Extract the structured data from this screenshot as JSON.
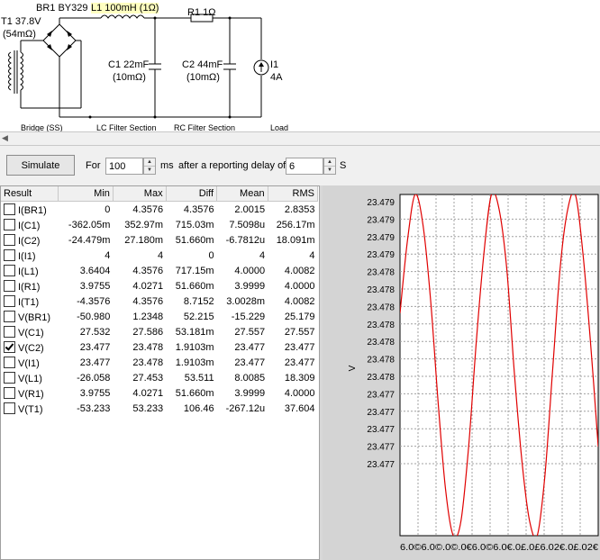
{
  "schematic": {
    "t1": {
      "name": "T1 37.8V",
      "res": "(54mΩ)"
    },
    "br1": "BR1 BY329",
    "l1": "L1 100mH (1Ω)",
    "r1": "R1 1Ω",
    "c1": {
      "name": "C1 22mF",
      "res": "(10mΩ)"
    },
    "c2": {
      "name": "C2 44mF",
      "res": "(10mΩ)"
    },
    "i1": {
      "name": "I1",
      "value": "4A"
    },
    "sections": [
      "Bridge (SS)",
      "LC Filter Section",
      "RC Filter Section",
      "Load"
    ]
  },
  "toolbar": {
    "simulate": "Simulate",
    "for": "For",
    "duration": "100",
    "ms": "ms",
    "delay_text": "after a reporting delay of",
    "delay": "6",
    "s": "S"
  },
  "results": {
    "headers": [
      "Result",
      "Min",
      "Max",
      "Diff",
      "Mean",
      "RMS"
    ],
    "rows": [
      {
        "checked": false,
        "cells": [
          "I(BR1)",
          "0",
          "4.3576",
          "4.3576",
          "2.0015",
          "2.8353"
        ]
      },
      {
        "checked": false,
        "cells": [
          "I(C1)",
          "-362.05m",
          "352.97m",
          "715.03m",
          "7.5098u",
          "256.17m"
        ]
      },
      {
        "checked": false,
        "cells": [
          "I(C2)",
          "-24.479m",
          "27.180m",
          "51.660m",
          "-6.7812u",
          "18.091m"
        ]
      },
      {
        "checked": false,
        "cells": [
          "I(I1)",
          "4",
          "4",
          "0",
          "4",
          "4"
        ]
      },
      {
        "checked": false,
        "cells": [
          "I(L1)",
          "3.6404",
          "4.3576",
          "717.15m",
          "4.0000",
          "4.0082"
        ]
      },
      {
        "checked": false,
        "cells": [
          "I(R1)",
          "3.9755",
          "4.0271",
          "51.660m",
          "3.9999",
          "4.0000"
        ]
      },
      {
        "checked": false,
        "cells": [
          "I(T1)",
          "-4.3576",
          "4.3576",
          "8.7152",
          "3.0028m",
          "4.0082"
        ]
      },
      {
        "checked": false,
        "cells": [
          "V(BR1)",
          "-50.980",
          "1.2348",
          "52.215",
          "-15.229",
          "25.179"
        ]
      },
      {
        "checked": false,
        "cells": [
          "V(C1)",
          "27.532",
          "27.586",
          "53.181m",
          "27.557",
          "27.557"
        ]
      },
      {
        "checked": true,
        "cells": [
          "V(C2)",
          "23.477",
          "23.478",
          "1.9103m",
          "23.477",
          "23.477"
        ]
      },
      {
        "checked": false,
        "cells": [
          "V(I1)",
          "23.477",
          "23.478",
          "1.9103m",
          "23.477",
          "23.477"
        ]
      },
      {
        "checked": false,
        "cells": [
          "V(L1)",
          "-26.058",
          "27.453",
          "53.511",
          "8.0085",
          "18.309"
        ]
      },
      {
        "checked": false,
        "cells": [
          "V(R1)",
          "3.9755",
          "4.0271",
          "51.660m",
          "3.9999",
          "4.0000"
        ]
      },
      {
        "checked": false,
        "cells": [
          "V(T1)",
          "-53.233",
          "53.233",
          "106.46",
          "-267.12u",
          "37.604"
        ]
      }
    ]
  },
  "chart_data": {
    "type": "line",
    "ylabel": "V",
    "y_ticks": [
      "23.479",
      "23.479",
      "23.479",
      "23.479",
      "23.478",
      "23.478",
      "23.478",
      "23.478",
      "23.478",
      "23.478",
      "23.478",
      "23.477",
      "23.477",
      "23.477",
      "23.477",
      "23.477"
    ],
    "x_tick_text": "6.0©6.0©.0©.0€6.0©6.0€.0£.0£6.02€.0£.02€",
    "x_ticks": [
      "6.00",
      "6.00",
      "6.00",
      "6.00",
      "6.01",
      "6.01",
      "6.01",
      "6.01",
      "6.02",
      "6.02",
      "6.02",
      "6.02"
    ],
    "xlim": [
      6.0,
      6.026
    ],
    "ylim": [
      23.4768,
      23.4791
    ],
    "series": [
      {
        "color": "#e00000",
        "x": [
          6.0,
          6.001,
          6.002,
          6.003,
          6.004,
          6.005,
          6.006,
          6.007,
          6.008,
          6.009,
          6.01,
          6.011,
          6.012,
          6.013,
          6.014,
          6.015,
          6.016,
          6.017,
          6.018,
          6.019,
          6.02,
          6.021,
          6.022,
          6.023,
          6.024,
          6.025,
          6.026
        ],
        "y": [
          23.4783,
          23.4788,
          23.4791,
          23.4789,
          23.4784,
          23.4777,
          23.4771,
          23.4768,
          23.4769,
          23.4774,
          23.4781,
          23.4787,
          23.4791,
          23.479,
          23.4786,
          23.4779,
          23.4773,
          23.4769,
          23.4768,
          23.4772,
          23.4779,
          23.4786,
          23.479,
          23.4791,
          23.4787,
          23.4781,
          23.4774
        ]
      }
    ],
    "grid": true
  }
}
